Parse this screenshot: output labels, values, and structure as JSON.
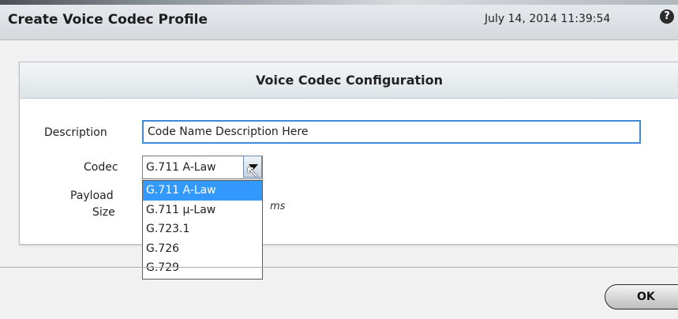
{
  "window": {
    "title": "Create Voice Codec Profile",
    "datetime": "July 14, 2014 11:39:54",
    "help_glyph": "?"
  },
  "panel": {
    "header": "Voice Codec Configuration"
  },
  "form": {
    "description_label": "Description",
    "description_value": "Code Name Description Here",
    "codec_label": "Codec",
    "codec_value": "G.711 A-Law",
    "payload_label_line1": "Payload",
    "payload_label_line2": "Size",
    "payload_unit": "ms"
  },
  "codec_options": [
    "G.711 A-Law",
    "G.711 μ-Law",
    "G.723.1",
    "G.726",
    "G.729"
  ],
  "selected_option_index": 0,
  "buttons": {
    "ok": "OK"
  },
  "colors": {
    "selection": "#3399ff",
    "input_focus_border": "#3c8ad8"
  },
  "icons": {
    "help": "question-circle-icon",
    "dropdown": "chevron-down-icon",
    "cursor": "mouse-pointer-icon"
  }
}
